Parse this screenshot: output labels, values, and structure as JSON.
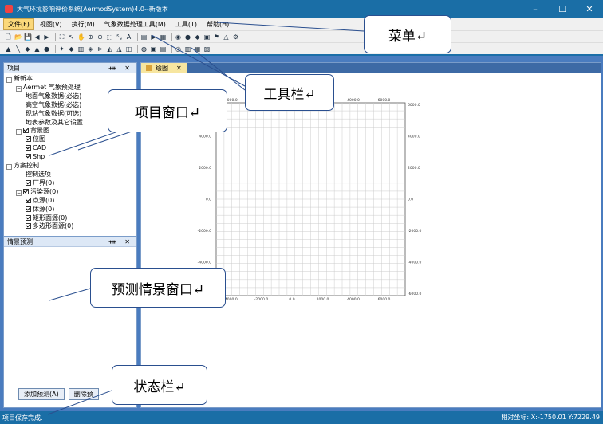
{
  "window": {
    "title": "大气环境影响评价系统(AermodSystem)4.0--新版本",
    "min": "–",
    "max": "☐",
    "close": "✕"
  },
  "menu": [
    "文件(F)",
    "视图(V)",
    "执行(M)",
    "气象数据处理工具(M)",
    "工具(T)",
    "帮助(H)"
  ],
  "toolbar1": [
    "🗋",
    "📂",
    "💾",
    "◀",
    "▶",
    "⛶",
    "↖",
    "✋",
    "⊕",
    "⊖",
    "⬚",
    "⤡",
    "A",
    "▤",
    "▶",
    "▦",
    "◉",
    "●",
    "◆",
    "▣",
    "⚑",
    "△",
    "⚙"
  ],
  "toolbar2": [
    "▲",
    "╲",
    "◆",
    "▲",
    "●",
    "✦",
    "◆",
    "▥",
    "◈",
    "⊳",
    "◭",
    "◮",
    "◫",
    "◍",
    "▣",
    "▤",
    "◎",
    "▥",
    "▦",
    "▨"
  ],
  "project_panel": {
    "title": "项目",
    "controls": "ᚓ ✕",
    "tree": [
      {
        "label": "新新本",
        "level": 0,
        "expander": "⊟"
      },
      {
        "label": "Aermet 气象预处理",
        "level": 1,
        "expander": "⊟"
      },
      {
        "label": "地面气象数据(必选)",
        "level": 2
      },
      {
        "label": "高空气象数据(必选)",
        "level": 2
      },
      {
        "label": "现站气象数据(可选)",
        "level": 2
      },
      {
        "label": "地表参数及其它设置",
        "level": 2
      },
      {
        "label": "背景图",
        "level": 1,
        "expander": "⊟",
        "check": true
      },
      {
        "label": "位图",
        "level": 2,
        "check": true
      },
      {
        "label": "CAD",
        "level": 2,
        "check": true
      },
      {
        "label": "Shp",
        "level": 2,
        "check": true
      },
      {
        "label": "方案控制",
        "level": 0,
        "expander": "⊟"
      },
      {
        "label": "控制选项",
        "level": 2
      },
      {
        "label": "厂界(0)",
        "level": 2,
        "check": true
      },
      {
        "label": "污染源(0)",
        "level": 1,
        "expander": "⊟",
        "check": true
      },
      {
        "label": "点源(0)",
        "level": 2,
        "check": true
      },
      {
        "label": "体源(0)",
        "level": 2,
        "check": true
      },
      {
        "label": "矩形面源(0)",
        "level": 2,
        "check": true
      },
      {
        "label": "多边形面源(0)",
        "level": 2,
        "check": true
      }
    ]
  },
  "scenario_panel": {
    "title": "情景预测",
    "controls": "ᚓ ✕",
    "add_button": "添加预测(A)",
    "delete_button": "删除预"
  },
  "map": {
    "tab": "绘图",
    "tab_close": "✕",
    "x_ticks": [
      "-4000.0",
      "-2000.0",
      "0.0",
      "2000.0",
      "4000.0",
      "6000.0"
    ],
    "y_ticks": [
      "6000.0",
      "4000.0",
      "2000.0",
      "0.0",
      "-2000.0",
      "-4000.0",
      "-6000.0"
    ]
  },
  "status": {
    "message": "项目保存完成.",
    "coord_label": "相对坐标:",
    "x": "X:-1750.01",
    "y": "Y:7229.49"
  },
  "callouts": {
    "menu": "菜单↵",
    "toolbar": "工具栏↵",
    "project": "项目窗口↵",
    "scenario": "预测情景窗口↵",
    "status": "状态栏↵"
  }
}
